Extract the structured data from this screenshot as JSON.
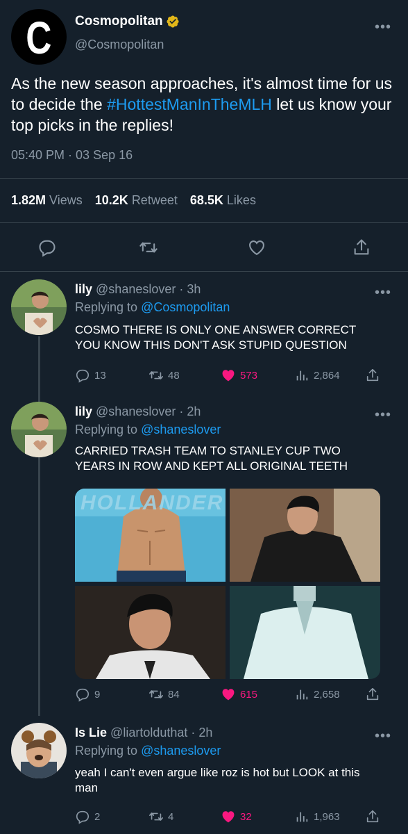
{
  "tweet": {
    "logo_letter": "C",
    "display_name": "Cosmopolitan",
    "handle": "@Cosmopolitan",
    "text_before": "As the new season approaches, it's almost time for us to decide the ",
    "hashtag": "#HottestManInTheMLH",
    "text_after": " let us know your top picks in the replies!",
    "timestamp": "05:40 PM · 03 Sep 16",
    "views_count": "1.82M",
    "views_label": "Views",
    "retweets_count": "10.2K",
    "retweets_label": "Retweet",
    "likes_count": "68.5K",
    "likes_label": "Likes",
    "more": "•••"
  },
  "replies": [
    {
      "name": "lily",
      "handle": "@shaneslover",
      "time": "· 3h",
      "replying_prefix": "Replying to",
      "replying_to": "@Cosmopolitan",
      "text_line1": "COSMO THERE IS ONLY ONE ANSWER CORRECT",
      "text_line2": "YOU KNOW THIS DON'T ASK STUPID QUESTION",
      "replies": "13",
      "retweets": "48",
      "likes": "573",
      "views": "2,864"
    },
    {
      "name": "lily",
      "handle": "@shaneslover",
      "time": "· 2h",
      "replying_prefix": "Replying to",
      "replying_to": "@shaneslover",
      "text_line1": "CARRIED TRASH TEAM TO STANLEY CUP TWO",
      "text_line2": "YEARS IN ROW AND KEPT ALL ORIGINAL TEETH",
      "media_overlay_text": "HOLLANDER",
      "replies": "9",
      "retweets": "84",
      "likes": "615",
      "views": "2,658"
    },
    {
      "name": "Is Lie",
      "handle": "@liartolduthat",
      "time": "· 2h",
      "replying_prefix": "Replying to",
      "replying_to": "@shaneslover",
      "text_line1": "yeah I can't even argue like roz is hot but LOOK at this",
      "text_line2": "man",
      "replies": "2",
      "retweets": "4",
      "likes": "32",
      "views": "1,963"
    }
  ],
  "colors": {
    "background": "#15202b",
    "link": "#1d9bf0",
    "muted": "#8b98a5",
    "like": "#f91880",
    "verified": "#e2b719"
  }
}
